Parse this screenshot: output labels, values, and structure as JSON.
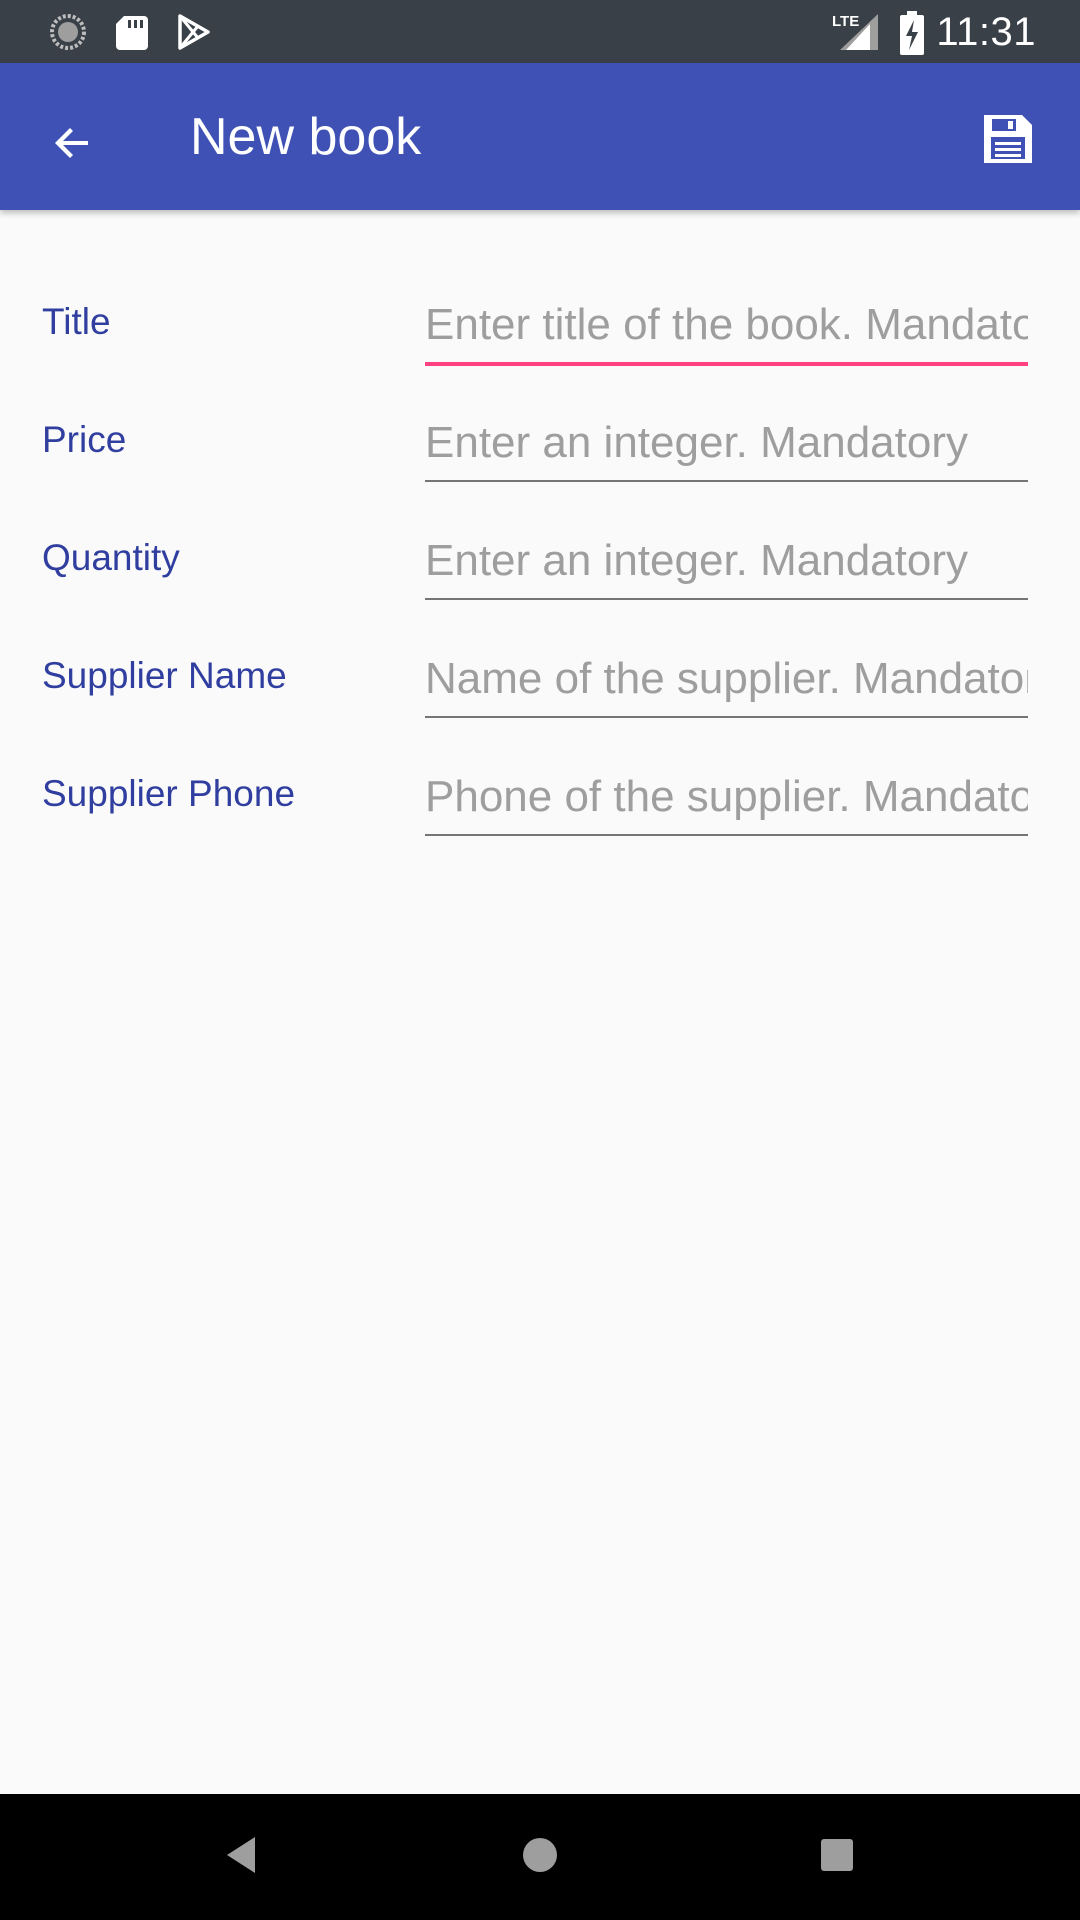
{
  "status_bar": {
    "time": "11:31",
    "network_label": "LTE",
    "icons": [
      "loading-icon",
      "sd-card-icon",
      "play-store-icon",
      "signal-icon",
      "battery-charging-icon"
    ]
  },
  "app_bar": {
    "title": "New book",
    "back_icon": "arrow-back-icon",
    "save_icon": "save-icon"
  },
  "form": {
    "fields": [
      {
        "label": "Title",
        "placeholder": "Enter title of the book. Mandatory",
        "value": "",
        "focused": true
      },
      {
        "label": "Price",
        "placeholder": "Enter an integer. Mandatory",
        "value": "",
        "focused": false
      },
      {
        "label": "Quantity",
        "placeholder": "Enter an integer. Mandatory",
        "value": "",
        "focused": false
      },
      {
        "label": "Supplier Name",
        "placeholder": "Name of the supplier. Mandatory",
        "value": "",
        "focused": false
      },
      {
        "label": "Supplier Phone",
        "placeholder": "Phone of the supplier. Mandatory",
        "value": "",
        "focused": false
      }
    ]
  },
  "nav_bar": {
    "buttons": [
      "back-triangle-icon",
      "home-circle-icon",
      "recents-square-icon"
    ]
  },
  "colors": {
    "status_bar": "#3a4048",
    "app_bar": "#3f51b5",
    "label": "#303f9f",
    "focus_underline": "#ff4081",
    "underline": "#757575",
    "placeholder": "#9e9e9e",
    "background": "#fafafa"
  }
}
